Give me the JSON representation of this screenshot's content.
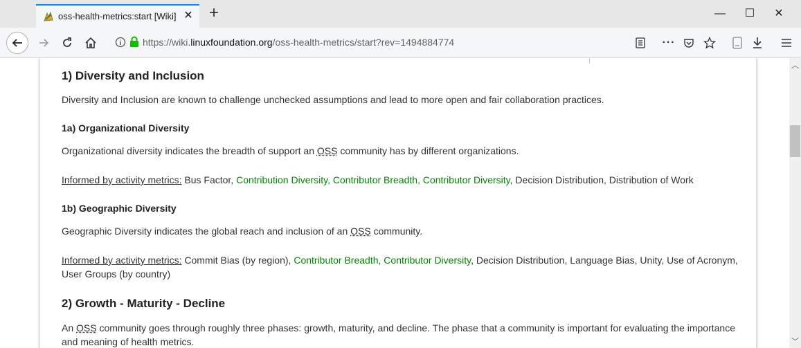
{
  "browser": {
    "tab": {
      "title": "oss-health-metrics:start [Wiki]"
    },
    "url": {
      "prefix": "https://wiki.",
      "domain": "linuxfoundation.org",
      "path": "/oss-health-metrics/start?rev=1494884774"
    }
  },
  "content": {
    "section1": {
      "heading": "1) Diversity and Inclusion",
      "intro": "Diversity and Inclusion are known to challenge unchecked assumptions and lead to more open and fair collaboration practices."
    },
    "section1a": {
      "heading": "1a) Organizational Diversity",
      "desc_before": "Organizational diversity indicates the breadth of support an ",
      "desc_abbr": "OSS",
      "desc_after": " community has by different organizations.",
      "metrics_label": "Informed by activity metrics:",
      "m1": " Bus Factor, ",
      "link1": "Contribution Diversity,",
      "sp1": " ",
      "link2": "Contributor Breadth,",
      "sp2": " ",
      "link3": "Contributor Diversity",
      "m2": ", Decision Distribution, Distribution of Work"
    },
    "section1b": {
      "heading": "1b) Geographic Diversity",
      "desc_before": "Geographic Diversity indicates the global reach and inclusion of an ",
      "desc_abbr": "OSS",
      "desc_after": " community.",
      "metrics_label": "Informed by activity metrics:",
      "m1": " Commit Bias (by region), ",
      "link1": "Contributor Breadth,",
      "sp1": " ",
      "link2": "Contributor Diversity",
      "m2": ", Decision Distribution, Language Bias, Unity, Use of Acronym, User Groups (by country)"
    },
    "section2": {
      "heading": "2) Growth - Maturity - Decline",
      "desc_before": "An ",
      "desc_abbr": "OSS",
      "desc_after": " community goes through roughly three phases: growth, maturity, and decline. The phase that a community is important for evaluating the importance and meaning of health metrics."
    }
  },
  "colors": {
    "link_green": "#008800",
    "tab_accent": "#0a84ff",
    "lock_green": "#12bc00"
  }
}
